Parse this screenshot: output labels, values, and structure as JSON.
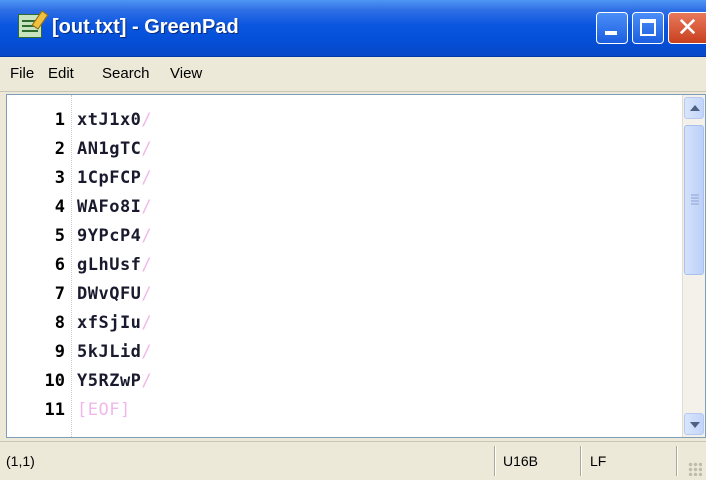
{
  "window": {
    "title": "[out.txt] - GreenPad"
  },
  "menu": {
    "items": [
      "File",
      "Edit",
      "Search",
      "View"
    ]
  },
  "editor": {
    "lines": [
      {
        "num": "1",
        "text": "xtJ1x0",
        "eol": "/"
      },
      {
        "num": "2",
        "text": "AN1gTC",
        "eol": "/"
      },
      {
        "num": "3",
        "text": "1CpFCP",
        "eol": "/"
      },
      {
        "num": "4",
        "text": "WAFo8I",
        "eol": "/"
      },
      {
        "num": "5",
        "text": "9YPcP4",
        "eol": "/"
      },
      {
        "num": "6",
        "text": "gLhUsf",
        "eol": "/"
      },
      {
        "num": "7",
        "text": "DWvQFU",
        "eol": "/"
      },
      {
        "num": "8",
        "text": "xfSjIu",
        "eol": "/"
      },
      {
        "num": "9",
        "text": "5kJLid",
        "eol": "/"
      },
      {
        "num": "10",
        "text": "Y5RZwP",
        "eol": "/"
      }
    ],
    "eof_line": {
      "num": "11",
      "text": "[EOF]"
    }
  },
  "status": {
    "cursor": "(1,1)",
    "encoding": "U16B",
    "line_ending": "LF"
  },
  "colors": {
    "title_bar": "#0550d8",
    "eol_marker": "#f0b8ea",
    "close_button": "#c8401e"
  }
}
